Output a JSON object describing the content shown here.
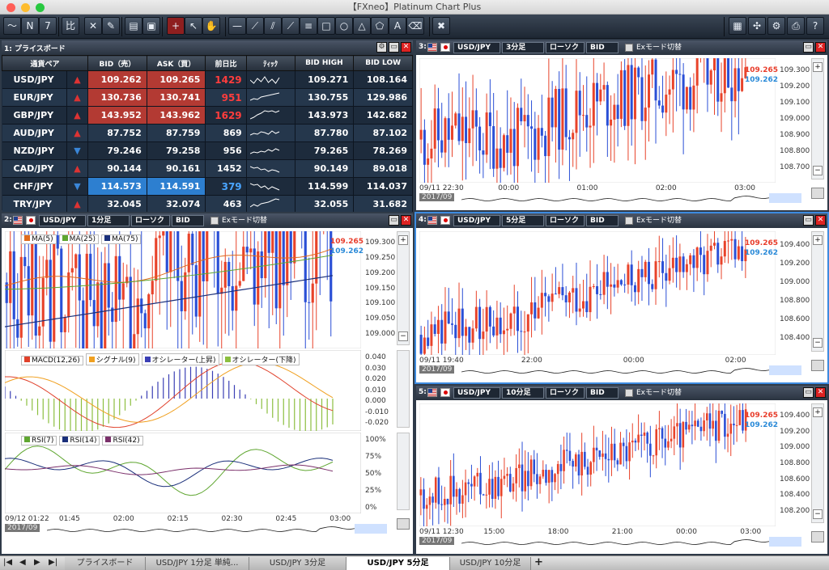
{
  "window": {
    "title": "【FXneo】Platinum Chart Plus"
  },
  "toolbar": {
    "icons": [
      "chart-line-icon",
      "news-icon",
      "calendar-icon",
      "compare-icon",
      "tools-icon",
      "pen-icon",
      "window-icon",
      "save-icon",
      "crosshair-icon",
      "cursor-icon",
      "hand-icon",
      "hline-icon",
      "trendline-icon",
      "parallel-icon",
      "ray-icon",
      "channel-icon",
      "rectangle-icon",
      "circle-icon",
      "triangle-icon",
      "fib-icon",
      "text-icon",
      "eraser-icon",
      "delete-icon",
      "layout-icon",
      "network-icon",
      "settings-icon",
      "print-icon",
      "help-icon"
    ],
    "compare_label": "比",
    "calendar_day": "7"
  },
  "price_board": {
    "title": "1: プライスボード",
    "columns": [
      "通貨ペア",
      "BID（売）",
      "ASK（買）",
      "前日比",
      "ﾃｨｯｸ",
      "BID HIGH",
      "BID LOW"
    ],
    "rows": [
      {
        "pair": "USD/JPY",
        "dir": "up",
        "bid": "109.262",
        "ask": "109.265",
        "change": "1429",
        "high": "109.271",
        "low": "108.164",
        "bidbg": "red",
        "chgcolor": "red"
      },
      {
        "pair": "EUR/JPY",
        "dir": "up",
        "bid": "130.736",
        "ask": "130.741",
        "change": "951",
        "high": "130.755",
        "low": "129.986",
        "bidbg": "red",
        "chgcolor": "red"
      },
      {
        "pair": "GBP/JPY",
        "dir": "up",
        "bid": "143.952",
        "ask": "143.962",
        "change": "1629",
        "high": "143.973",
        "low": "142.682",
        "bidbg": "red",
        "chgcolor": "red"
      },
      {
        "pair": "AUD/JPY",
        "dir": "up",
        "bid": "87.752",
        "ask": "87.759",
        "change": "869",
        "high": "87.780",
        "low": "87.102",
        "bidbg": "",
        "chgcolor": "white"
      },
      {
        "pair": "NZD/JPY",
        "dir": "down",
        "bid": "79.246",
        "ask": "79.258",
        "change": "956",
        "high": "79.265",
        "low": "78.269",
        "bidbg": "",
        "chgcolor": "white"
      },
      {
        "pair": "CAD/JPY",
        "dir": "up",
        "bid": "90.144",
        "ask": "90.161",
        "change": "1452",
        "high": "90.149",
        "low": "89.018",
        "bidbg": "",
        "chgcolor": "white"
      },
      {
        "pair": "CHF/JPY",
        "dir": "down",
        "bid": "114.573",
        "ask": "114.591",
        "change": "379",
        "high": "114.599",
        "low": "114.037",
        "bidbg": "blue",
        "chgcolor": "blue"
      },
      {
        "pair": "TRY/JPY",
        "dir": "up",
        "bid": "32.045",
        "ask": "32.074",
        "change": "463",
        "high": "32.055",
        "low": "31.682",
        "bidbg": "",
        "chgcolor": "white"
      }
    ]
  },
  "charts": {
    "c2": {
      "num": "2:",
      "pair": "USD/JPY",
      "period": "1分足",
      "style": "ローソク",
      "side": "BID",
      "ex": "Exモード切替",
      "ask_price": "109.265",
      "bid_price": "109.262",
      "yaxis": [
        "109.300",
        "109.250",
        "109.200",
        "109.150",
        "109.100",
        "109.050",
        "109.000"
      ],
      "macd_axis": [
        "0.040",
        "0.030",
        "0.020",
        "0.010",
        "0.000",
        "-0.010",
        "-0.020"
      ],
      "rsi_axis": [
        "100%",
        "75%",
        "50%",
        "25%",
        "0%"
      ],
      "xaxis": [
        "09/12 01:22",
        "01:45",
        "02:00",
        "02:15",
        "02:30",
        "02:45",
        "03:00"
      ],
      "year": "2017/09",
      "legend_ma": [
        "MA(5)",
        "MA(25)",
        "MA(75)"
      ],
      "legend_macd": [
        "MACD(12,26)",
        "シグナル(9)",
        "オシレーター(上昇)",
        "オシレーター(下降)"
      ],
      "legend_rsi": [
        "RSI(7)",
        "RSI(14)",
        "RSI(42)"
      ]
    },
    "c3": {
      "num": "3:",
      "pair": "USD/JPY",
      "period": "3分足",
      "style": "ローソク",
      "side": "BID",
      "ex": "Exモード切替",
      "ask_price": "109.265",
      "bid_price": "109.262",
      "yaxis": [
        "109.300",
        "109.200",
        "109.100",
        "109.000",
        "108.900",
        "108.800",
        "108.700"
      ],
      "xaxis": [
        "09/11 22:30",
        "00:00",
        "01:00",
        "02:00",
        "03:00"
      ],
      "year": "2017/09"
    },
    "c4": {
      "num": "4:",
      "pair": "USD/JPY",
      "period": "5分足",
      "style": "ローソク",
      "side": "BID",
      "ex": "Exモード切替",
      "ask_price": "109.265",
      "bid_price": "109.262",
      "yaxis": [
        "109.400",
        "109.200",
        "109.000",
        "108.800",
        "108.600",
        "108.400"
      ],
      "xaxis": [
        "09/11 19:40",
        "22:00",
        "00:00",
        "02:00"
      ],
      "year": "2017/09"
    },
    "c5": {
      "num": "5:",
      "pair": "USD/JPY",
      "period": "10分足",
      "style": "ローソク",
      "side": "BID",
      "ex": "Exモード切替",
      "ask_price": "109.265",
      "bid_price": "109.262",
      "yaxis": [
        "109.400",
        "109.200",
        "109.000",
        "108.800",
        "108.600",
        "108.400",
        "108.200"
      ],
      "xaxis": [
        "09/11 12:30",
        "15:00",
        "18:00",
        "21:00",
        "00:00",
        "03:00"
      ],
      "year": "2017/09"
    }
  },
  "tabs": [
    "プライスボード",
    "USD/JPY 1分足 単純...",
    "USD/JPY 3分足",
    "USD/JPY 5分足",
    "USD/JPY 10分足"
  ],
  "active_tab": 3,
  "colors": {
    "up": "#e8432a",
    "down": "#2a4fd6",
    "ask": "#e83c2a",
    "bid": "#2a8ad8"
  }
}
